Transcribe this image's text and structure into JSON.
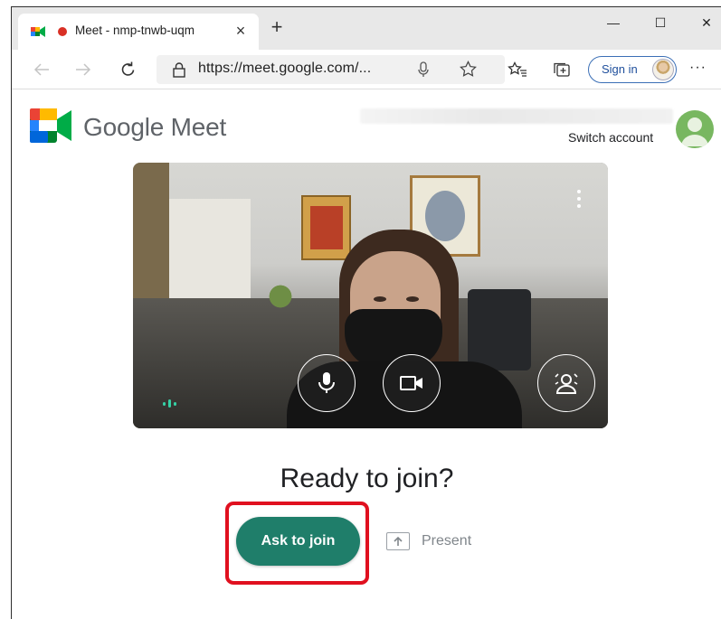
{
  "browser": {
    "tab_title": "Meet - nmp-tnwb-uqm",
    "tab_close": "×",
    "new_tab": "+",
    "address": "https://meet.google.com/...",
    "signin_label": "Sign in",
    "more": "···",
    "window_controls": {
      "minimize": "—",
      "maximize": "☐",
      "close": "✕"
    },
    "recording_color": "#d93025"
  },
  "page": {
    "brand": "Google Meet",
    "switch_account": "Switch account",
    "ready_heading": "Ready to join?",
    "ask_to_join": "Ask to join",
    "present": "Present",
    "accent_color": "#1f7e6a",
    "highlight_color": "#e0101f"
  },
  "icons": [
    "meet-favicon-icon",
    "back-arrow-icon",
    "forward-arrow-icon",
    "refresh-icon",
    "lock-icon",
    "microphone-icon",
    "star-icon",
    "favorites-icon",
    "collections-icon",
    "more-icon",
    "microphone-toggle-icon",
    "camera-toggle-icon",
    "visual-effects-icon",
    "audio-level-icon",
    "present-icon"
  ]
}
